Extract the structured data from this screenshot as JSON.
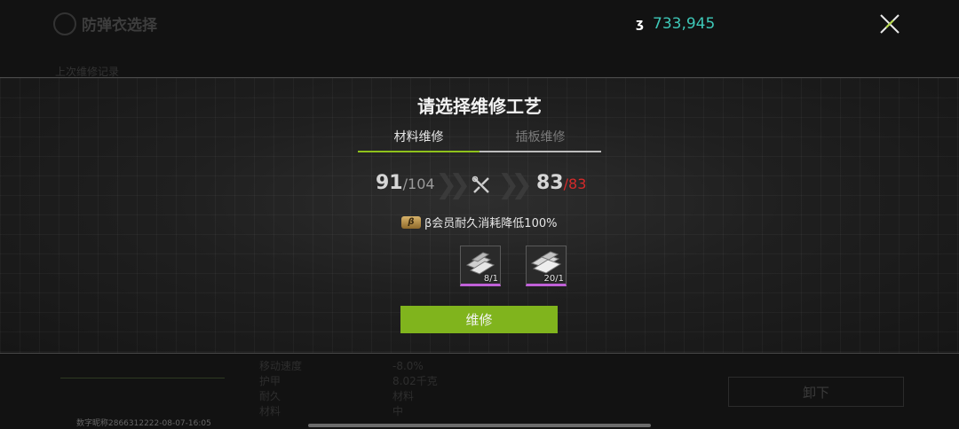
{
  "background": {
    "title": "防弹衣选择",
    "subtitle": "上次维修记录",
    "watermark": "数字昵称2866312222-08-07-16:05",
    "unload_button": "卸下",
    "stats_left": [
      "移动速度",
      "护甲",
      "耐久",
      "材料"
    ],
    "stats_right": [
      "-8.0%",
      "8.02千克",
      "材料",
      "中"
    ]
  },
  "hud": {
    "currency_icon": "ʒ",
    "currency_value": "733,945",
    "close_icon": "close-icon"
  },
  "modal": {
    "title": "请选择维修工艺",
    "tabs": [
      {
        "label": "材料维修",
        "active": true
      },
      {
        "label": "插板维修",
        "active": false
      }
    ],
    "durability_before": {
      "current": "91",
      "max": "/104"
    },
    "durability_after": {
      "current": "83",
      "max": "/83"
    },
    "member_badge": "β",
    "member_text": "β会员耐久消耗降低100%",
    "materials": [
      {
        "icon": "material-parts-icon",
        "count": "8/1",
        "rarity_color": "#c060d8"
      },
      {
        "icon": "material-plates-icon",
        "count": "20/1",
        "rarity_color": "#c060d8"
      }
    ],
    "repair_button": "维修"
  },
  "colors": {
    "accent_green": "#80b41d",
    "currency_teal": "#3ec8b8",
    "warning_red": "#d42a2a",
    "rarity_purple": "#c060d8"
  }
}
